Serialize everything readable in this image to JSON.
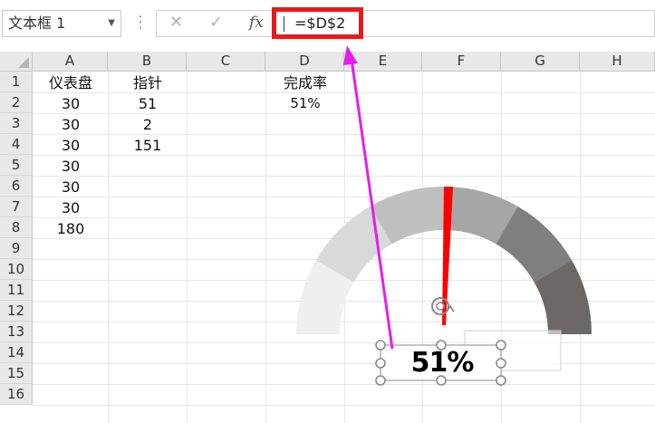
{
  "name_box": {
    "value": "文本框 1"
  },
  "formula_bar": {
    "cancel_icon": "close-icon",
    "enter_icon": "check-icon",
    "fx_label": "fx",
    "formula": "=$D$2"
  },
  "columns": [
    "A",
    "B",
    "C",
    "D",
    "E",
    "F",
    "G",
    "H"
  ],
  "rows": [
    "1",
    "2",
    "3",
    "4",
    "5",
    "6",
    "7",
    "8",
    "9",
    "10",
    "11",
    "12",
    "13",
    "14",
    "15",
    "16"
  ],
  "cells": {
    "A": [
      "仪表盘",
      "30",
      "30",
      "30",
      "30",
      "30",
      "30",
      "180"
    ],
    "B": [
      "指针",
      "51",
      "2",
      "151"
    ],
    "D": [
      "完成率",
      "51%"
    ]
  },
  "chart_data": {
    "type": "gauge",
    "segments": [
      30,
      30,
      30,
      30,
      30,
      30,
      180
    ],
    "pointer": [
      51,
      2,
      151
    ],
    "value_label": "51%",
    "colors": {
      "band1": "#efefef",
      "band2": "#d9d9d9",
      "band3": "#bfbfbf",
      "band4": "#a6a6a6",
      "band5": "#7f7f7f",
      "band6": "#6d6866",
      "pointer": "#ff0000"
    }
  },
  "annotations": {
    "highlight_color": "#e81b1b",
    "arrow_color": "#e61cf0"
  }
}
